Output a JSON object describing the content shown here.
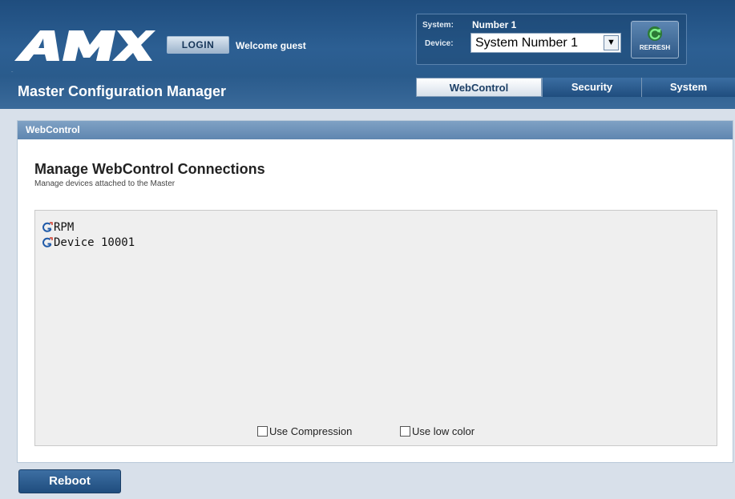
{
  "header": {
    "logo_text": "AMX",
    "login_label": "LOGIN",
    "welcome_text": "Welcome guest",
    "system_label": "System:",
    "system_value": "Number 1",
    "device_label": "Device:",
    "device_value": "System Number 1",
    "refresh_label": "REFRESH",
    "title": "Master Configuration Manager"
  },
  "tabs": [
    {
      "label": "WebControl",
      "active": true
    },
    {
      "label": "Security",
      "active": false
    },
    {
      "label": "System",
      "active": false
    }
  ],
  "panel": {
    "header": "WebControl",
    "title": "Manage WebControl Connections",
    "subtitle": "Manage devices attached to the Master",
    "devices": [
      {
        "name": "RPM",
        "icon": "g-connection-icon"
      },
      {
        "name": "Device 10001",
        "icon": "g-connection-icon"
      }
    ],
    "options": {
      "compression_label": "Use Compression",
      "compression_checked": false,
      "low_color_label": "Use low color",
      "low_color_checked": false
    }
  },
  "footer": {
    "reboot_label": "Reboot"
  },
  "colors": {
    "header_blue": "#2c5f93",
    "panel_header": "#6a8fb8",
    "background": "#d8e0ea",
    "refresh_green": "#3cc04a",
    "g_icon_blue": "#1f5aa8",
    "g_icon_red": "#d23a2a"
  }
}
